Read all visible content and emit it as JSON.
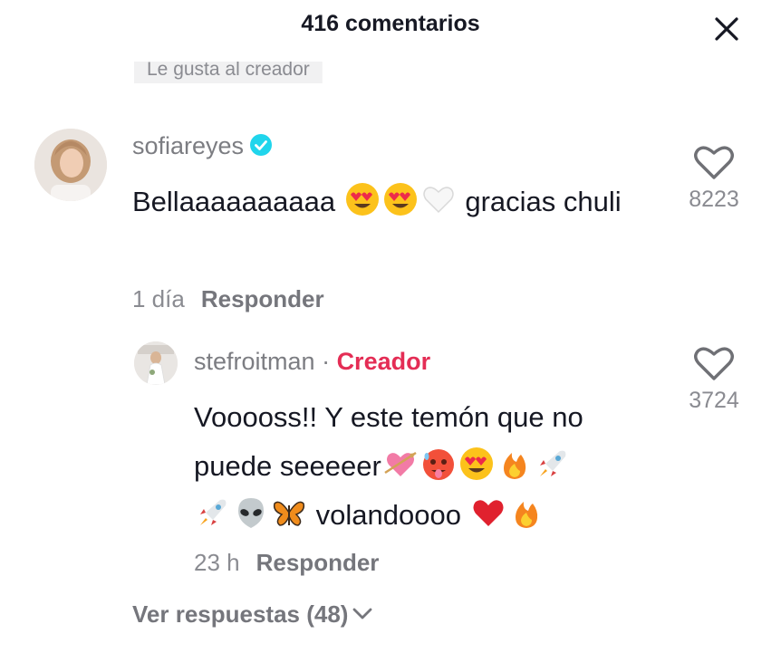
{
  "header": {
    "title": "416 comentarios",
    "close_icon": "close-icon"
  },
  "badge": {
    "text": "Le gusta al creador"
  },
  "comment": {
    "username": "sofiareyes",
    "verified": true,
    "text_part1": "Bellaaaaaaaaaa",
    "text_part2": "gracias chuli",
    "emojis": [
      "heart-eyes-emoji",
      "heart-eyes-emoji",
      "white-heart-emoji"
    ],
    "time": "1 día",
    "reply_label": "Responder",
    "likes": "8223"
  },
  "reply": {
    "username": "stefroitman",
    "separator": " · ",
    "creator_label": "Creador",
    "text_part1": "Vooooss!! Y este temón que no puede seeeeer",
    "text_part2": "volandoooo",
    "emojis": [
      "heart-with-arrow-emoji",
      "hot-face-emoji",
      "heart-eyes-emoji",
      "fire-emoji",
      "rocket-emoji",
      "rocket-emoji",
      "alien-emoji",
      "butterfly-emoji",
      "red-heart-emoji",
      "fire-emoji"
    ],
    "time": "23 h",
    "reply_label": "Responder",
    "likes": "3724"
  },
  "view_replies": {
    "label": "Ver respuestas (48)"
  },
  "colors": {
    "creator": "#e42d55",
    "verified": "#20d5ec",
    "text": "#161823",
    "secondary": "#8a8b91"
  }
}
